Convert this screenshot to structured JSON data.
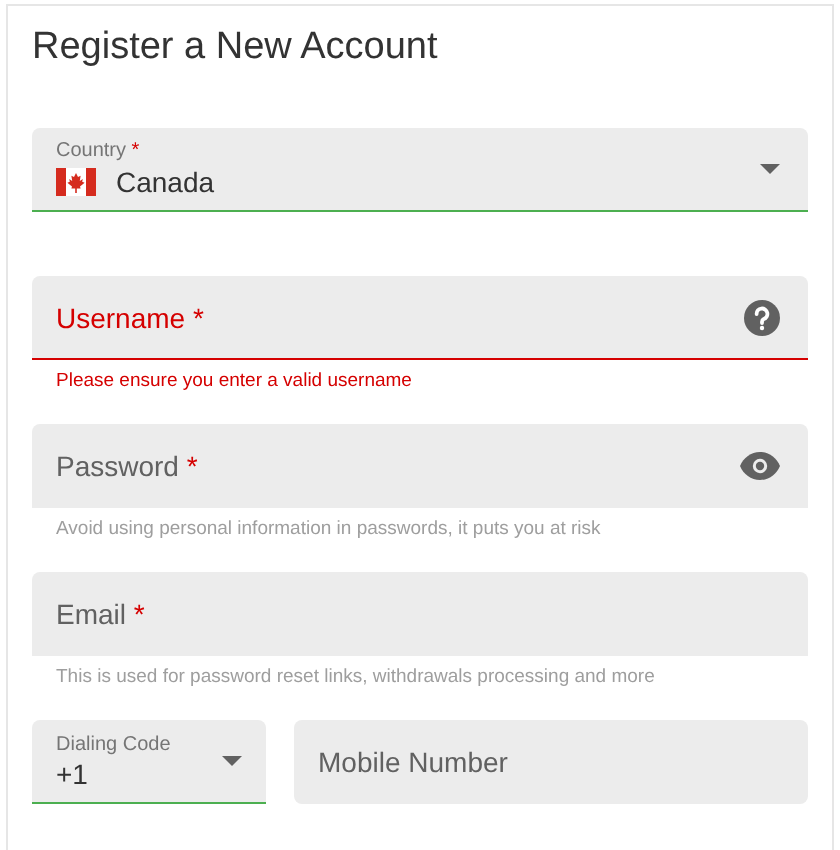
{
  "title": "Register a New Account",
  "fields": [
    {
      "kind": "select",
      "label": "Country",
      "required_mark": "*",
      "value": "Canada",
      "valid": true,
      "error": false
    },
    {
      "kind": "username",
      "label": "Username",
      "required_mark": "*",
      "valid": false,
      "error": true,
      "helper": "Please ensure you enter a valid username"
    },
    {
      "kind": "password",
      "label": "Password",
      "required_mark": "*",
      "valid": false,
      "error": false,
      "helper": "Avoid using personal information in passwords, it puts you at risk"
    },
    {
      "kind": "email",
      "label": "Email",
      "required_mark": "*",
      "valid": false,
      "error": false,
      "helper": "This is used for password reset links, withdrawals processing and more"
    }
  ],
  "phone": {
    "dialing_code": {
      "label": "Dialing Code",
      "value": "+1",
      "valid": true
    },
    "mobile": {
      "placeholder": "Mobile Number"
    }
  }
}
